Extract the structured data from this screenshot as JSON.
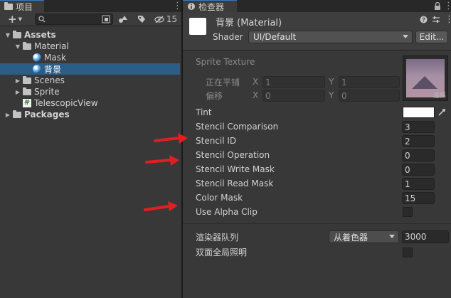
{
  "project_panel": {
    "tab_title": "项目",
    "hidden_count": "15",
    "tree": [
      {
        "label": "Assets",
        "bold": true
      },
      {
        "label": "Material"
      },
      {
        "label": "Mask"
      },
      {
        "label": "背景",
        "selected": true
      },
      {
        "label": "Scenes"
      },
      {
        "label": "Sprite"
      },
      {
        "label": "TelescopicView"
      },
      {
        "label": "Packages",
        "bold": true
      }
    ]
  },
  "inspector": {
    "tab_title": "检查器",
    "material_name": "背景 (Material)",
    "shader_label": "Shader",
    "shader_value": "UI/Default",
    "edit_button": "Edit...",
    "sprite_texture_label": "Sprite Texture",
    "tiling_label": "正在平铺",
    "offset_label": "偏移",
    "tiling_x": "1",
    "tiling_y": "1",
    "offset_x": "0",
    "offset_y": "0",
    "axis_x": "X",
    "axis_y": "Y",
    "select_label": "选择",
    "tint_label": "Tint",
    "properties": [
      {
        "label": "Stencil Comparison",
        "value": "3"
      },
      {
        "label": "Stencil ID",
        "value": "2"
      },
      {
        "label": "Stencil Operation",
        "value": "0"
      },
      {
        "label": "Stencil Write Mask",
        "value": "0"
      },
      {
        "label": "Stencil Read Mask",
        "value": "1"
      },
      {
        "label": "Color Mask",
        "value": "15"
      }
    ],
    "alpha_clip_label": "Use Alpha Clip",
    "render_queue_label": "渲染器队列",
    "render_queue_mode": "从着色器",
    "render_queue_value": "3000",
    "double_sided_gi_label": "双面全局照明"
  },
  "colors": {
    "selection": "#2c5d87",
    "tint": "#ffffff",
    "annotation_arrow": "#e02020"
  }
}
